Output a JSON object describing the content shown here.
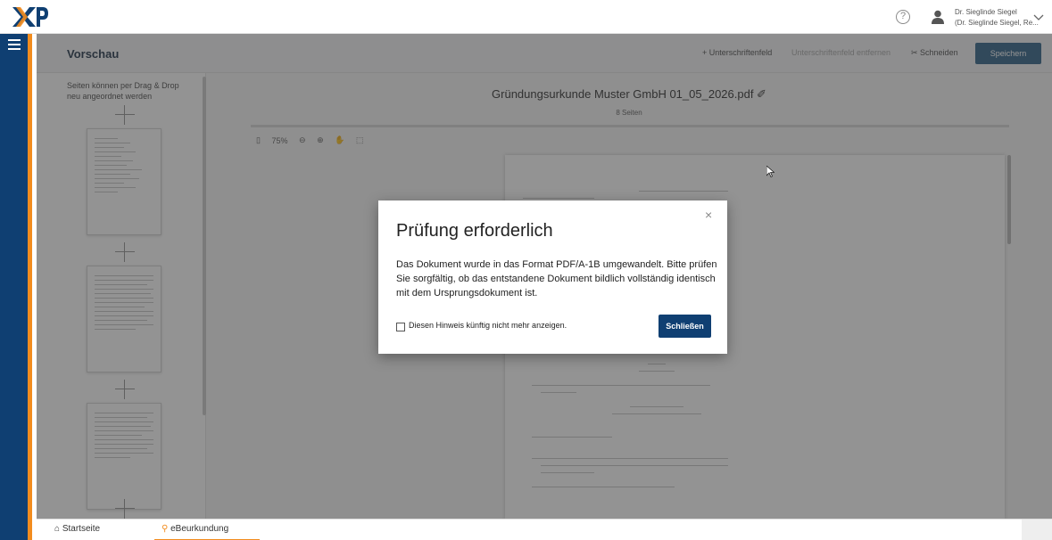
{
  "topbar": {
    "logo_text": "XP",
    "help_icon": "help-circle-icon",
    "user_name": "Dr. Sieglinde Siegel",
    "user_sub": "(Dr. Sieglinde Siegel, Re...",
    "chevron": "chevron-down-icon"
  },
  "header": {
    "title": "Vorschau",
    "add_label": "+ Unterschriftenfeld",
    "action2_label": "Unterschriftenfeld entfernen",
    "cut_label": "✂ Schneiden",
    "save_label": "Speichern"
  },
  "thumbnails": {
    "hint": "Seiten können per Drag & Drop neu angeordnet werden"
  },
  "document": {
    "title": "Gründungsurkunde Muster GmbH 01_05_2026.pdf ✐",
    "subtitle": "8 Seiten",
    "zoom": "75%"
  },
  "modal": {
    "title": "Prüfung erforderlich",
    "body": "Das Dokument wurde in das Format PDF/A-1B umgewandelt. Bitte prüfen Sie sorgfältig, ob das entstandene Dokument bildlich vollständig identisch mit dem Ursprungsdokument ist.",
    "checkbox_label": "Diesen Hinweis künftig nicht mehr anzeigen.",
    "checkbox_checked": false,
    "close_label": "Schließen",
    "close_icon": "×"
  },
  "taskbar": {
    "tabs": [
      {
        "label": "Startseite",
        "icon": "home-icon"
      },
      {
        "label": "eBeurkundung",
        "icon": "stamp-icon"
      }
    ]
  },
  "colors": {
    "sidebar": "#0f3f72",
    "accent": "#f28c1e",
    "primary_button": "#0f3f72"
  }
}
